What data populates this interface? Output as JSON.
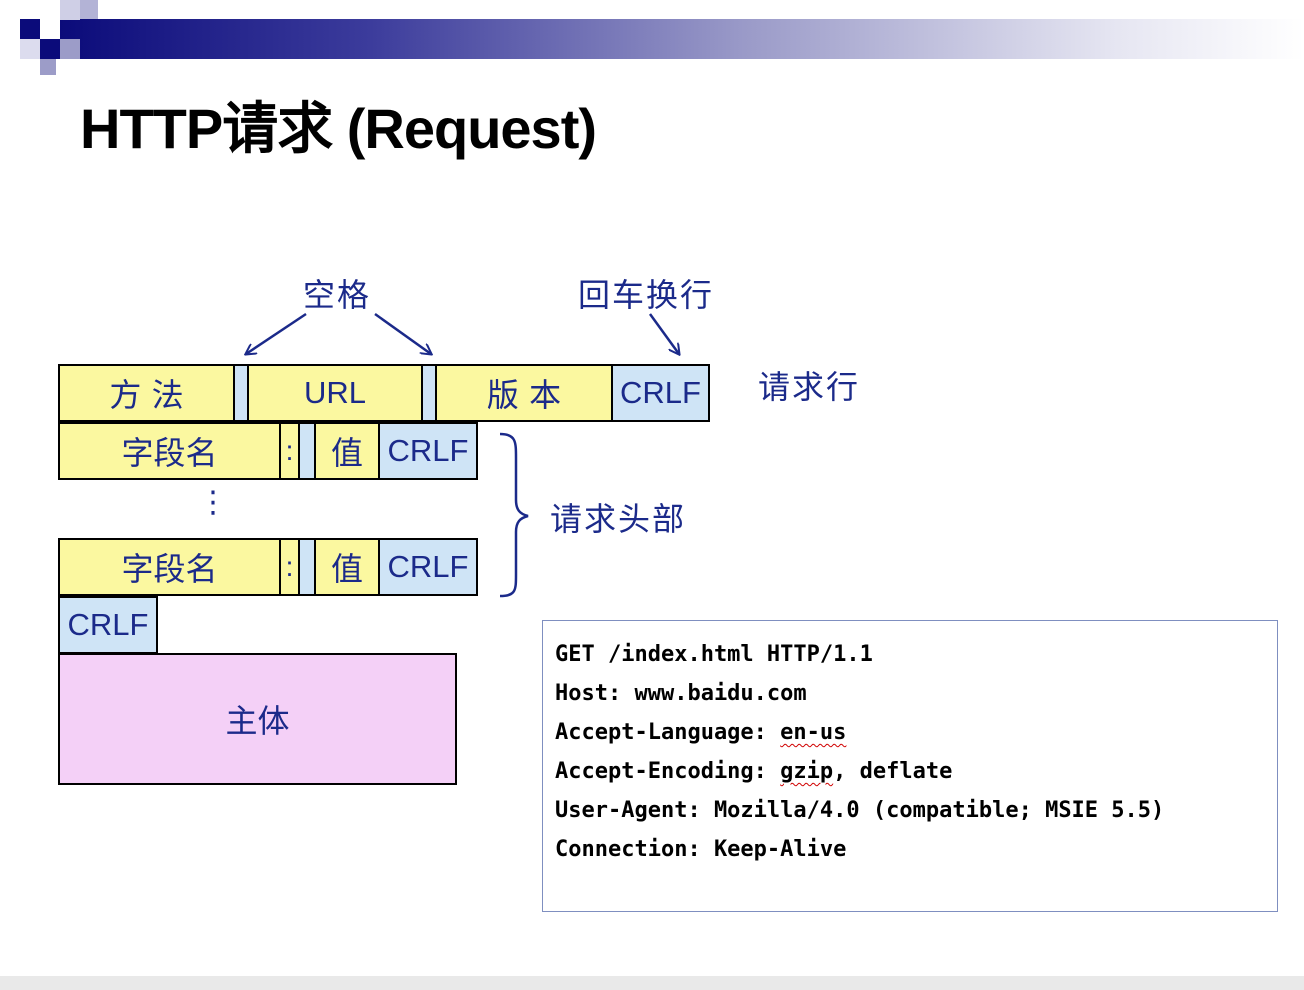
{
  "slide": {
    "title": "HTTP请求 (Request)"
  },
  "diagram": {
    "labels": {
      "space": "空格",
      "crlf_annotation": "回车换行",
      "request_line": "请求行",
      "request_headers": "请求头部"
    },
    "request_line": {
      "method": "方 法",
      "url": "URL",
      "version": "版 本",
      "crlf": "CRLF"
    },
    "header_rows": [
      {
        "name": "字段名",
        "colon": ":",
        "value": "值",
        "crlf": "CRLF"
      },
      {
        "name": "字段名",
        "colon": ":",
        "value": "值",
        "crlf": "CRLF"
      }
    ],
    "ellipsis": "⋮",
    "blank_line_crlf": "CRLF",
    "body": "主体"
  },
  "example": {
    "lines": [
      "GET /index.html HTTP/1.1",
      "Host: www.baidu.com",
      "Accept-Language: en-us",
      "Accept-Encoding: gzip, deflate",
      "User-Agent: Mozilla/4.0 (compatible; MSIE 5.5)",
      "Connection: Keep-Alive"
    ],
    "misspelled": [
      "en-us",
      "gzip"
    ]
  },
  "colors": {
    "field_yellow": "#fbf8a0",
    "field_blue": "#cfe4f6",
    "body_pink": "#f4d0f7",
    "label_blue": "#1b2a8a",
    "accent_navy": "#0b0b7a"
  }
}
